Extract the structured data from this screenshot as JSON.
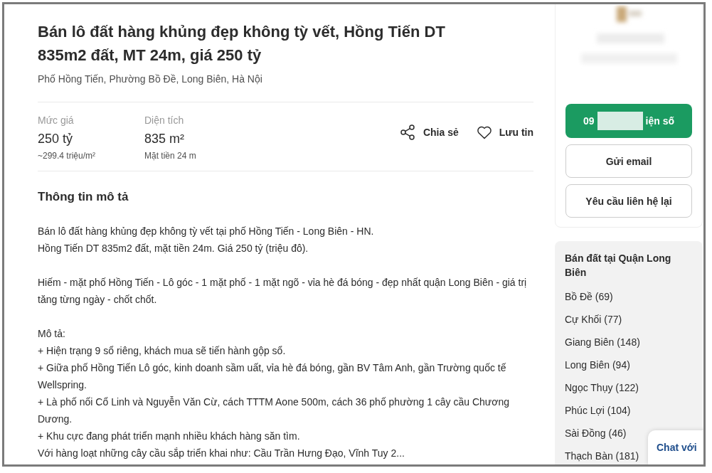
{
  "listing": {
    "title": "Bán lô đất hàng khủng đẹp không tỳ vết, Hồng Tiến DT 835m2 đất, MT 24m, giá 250 tỷ",
    "address": "Phố Hồng Tiến, Phường Bồ Đề, Long Biên, Hà Nội"
  },
  "facts": [
    {
      "label": "Mức giá",
      "value": "250 tỷ",
      "note": "~299.4 triệu/m²"
    },
    {
      "label": "Diện tích",
      "value": "835 m²",
      "note": "Mặt tiền 24 m"
    }
  ],
  "actions": [
    {
      "kind": "share",
      "label": "Chia sẻ"
    },
    {
      "kind": "save",
      "label": "Lưu tin"
    }
  ],
  "description": {
    "heading": "Thông tin mô tả",
    "paragraphs": [
      [
        "Bán lô đất hàng khủng đẹp không tỳ vết tại phố Hồng Tiến - Long Biên - HN.",
        "Hồng Tiến DT 835m2 đất, mặt tiền 24m. Giá 250 tỷ (triệu đô)."
      ],
      [
        "Hiếm - mặt phố Hồng Tiến - Lô góc - 1 mặt phố - 1 mặt ngõ - vỉa hè đá bóng - đẹp nhất quận Long Biên - giá trị tăng từng ngày - chốt chốt."
      ],
      [
        "Mô tả:",
        "+ Hiện trạng 9 sổ riêng, khách mua sẽ tiến hành gộp sổ.",
        "+ Giữa phố Hồng Tiến Lô góc, kinh doanh sầm uất, vỉa hè đá bóng, gần BV Tâm Anh, gần Trường quốc tế Wellspring.",
        "+ Là phố nối Cổ Linh và Nguyễn Văn Cừ, cách TTTM Aone 500m, cách 36 phố phường 1 cây cầu Chương Dương.",
        "+ Khu cực đang phát triển mạnh nhiều khách hàng săn tìm.",
        "Với hàng loạt những cây cầu sắp triển khai như: Cầu Trần Hưng Đạo, Vĩnh Tuy 2..."
      ]
    ]
  },
  "contact": {
    "phone_start": "09",
    "phone_end": "iện số",
    "buttons": [
      "Gửi email",
      "Yêu cầu liên hệ lại"
    ]
  },
  "sidebar": {
    "title": "Bán đất tại Quận Long Biên",
    "items": [
      "Bồ Đề (69)",
      "Cự Khối (77)",
      "Giang Biên (148)",
      "Long Biên (94)",
      "Ngọc Thụy (122)",
      "Phúc Lợi (104)",
      "Sài Đồng (46)",
      "Thạch Bàn (181)"
    ]
  },
  "chat": {
    "label": "Chat với"
  }
}
